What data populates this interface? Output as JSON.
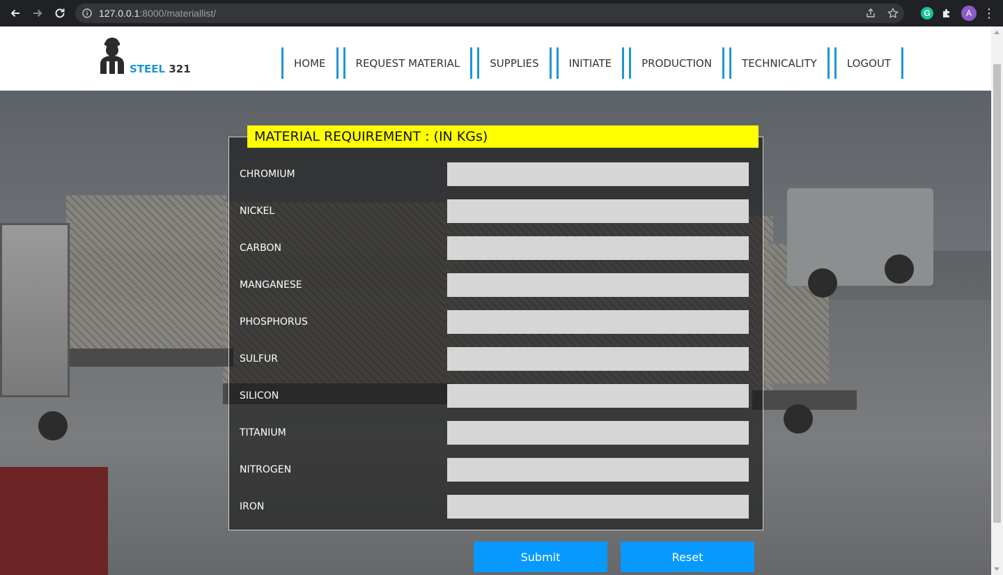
{
  "browser": {
    "url_host": "127.0.0.1",
    "url_rest": ":8000/materiallist/",
    "ext_letter": "G",
    "profile_initial": "A"
  },
  "header": {
    "logo_word1": "STEEL",
    "logo_word2": "321",
    "menu": [
      "HOME",
      "REQUEST MATERIAL",
      "SUPPLIES",
      "INITIATE",
      "PRODUCTION",
      "TECHNICALITY",
      "LOGOUT"
    ]
  },
  "form": {
    "title": "MATERIAL REQUIREMENT : (IN KGs)",
    "fields": [
      {
        "label": "CHROMIUM",
        "value": ""
      },
      {
        "label": "NICKEL",
        "value": ""
      },
      {
        "label": "CARBON",
        "value": ""
      },
      {
        "label": "MANGANESE",
        "value": ""
      },
      {
        "label": "PHOSPHORUS",
        "value": ""
      },
      {
        "label": "SULFUR",
        "value": ""
      },
      {
        "label": "SILICON",
        "value": ""
      },
      {
        "label": "TITANIUM",
        "value": ""
      },
      {
        "label": "NITROGEN",
        "value": ""
      },
      {
        "label": "IRON",
        "value": ""
      }
    ],
    "submit_label": "Submit",
    "reset_label": "Reset"
  }
}
